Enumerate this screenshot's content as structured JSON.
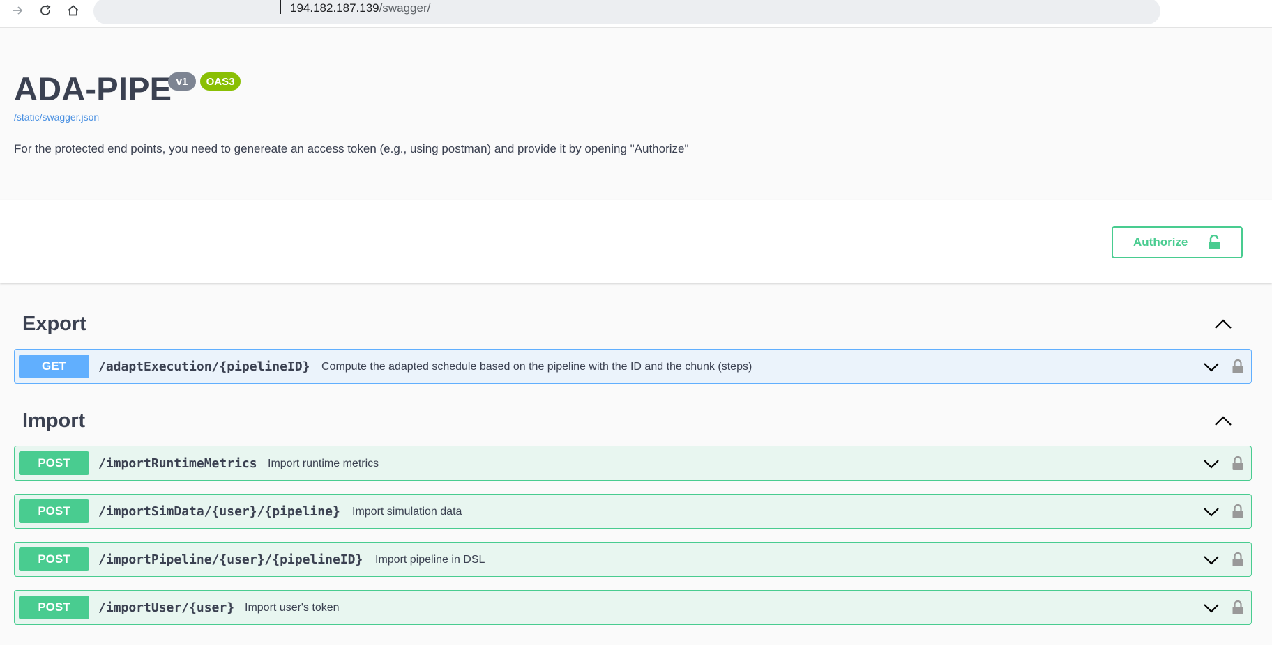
{
  "browser": {
    "address_host": "194.182.187.139",
    "address_path": "/swagger/"
  },
  "info": {
    "title": "ADA-PIPE",
    "version_badge": "v1",
    "oas_badge": "OAS3",
    "spec_link": "/static/swagger.json",
    "description": "For the protected end points, you need to genereate an access token (e.g., using postman) and provide it by opening \"Authorize\""
  },
  "auth": {
    "authorize_label": "Authorize"
  },
  "tags": [
    {
      "name": "Export",
      "operations": [
        {
          "method": "GET",
          "path": "/adaptExecution/{pipelineID}",
          "summary": "Compute the adapted schedule based on the pipeline with the ID and the chunk (steps)"
        }
      ]
    },
    {
      "name": "Import",
      "operations": [
        {
          "method": "POST",
          "path": "/importRuntimeMetrics",
          "summary": "Import runtime metrics"
        },
        {
          "method": "POST",
          "path": "/importSimData/{user}/{pipeline}",
          "summary": "Import simulation data"
        },
        {
          "method": "POST",
          "path": "/importPipeline/{user}/{pipelineID}",
          "summary": "Import pipeline in DSL"
        },
        {
          "method": "POST",
          "path": "/importUser/{user}",
          "summary": "Import user's token"
        }
      ]
    }
  ],
  "colors": {
    "get": "#61affe",
    "post": "#49cc90",
    "text": "#3b4151",
    "link": "#4990e2",
    "oas": "#89bf04"
  },
  "icons": [
    "arrow-forward-icon",
    "reload-icon",
    "home-icon",
    "lock-icon",
    "chevron-up-icon",
    "chevron-down-icon"
  ]
}
